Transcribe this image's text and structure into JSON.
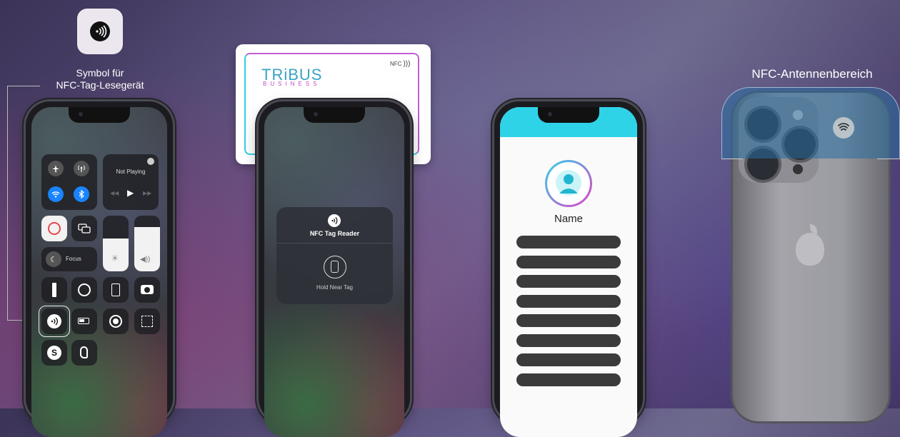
{
  "labels": {
    "reader_symbol_line1": "Symbol für",
    "reader_symbol_line2": "NFC-Tag-Lesegerät",
    "antenna_area": "NFC-Antennenbereich"
  },
  "control_center": {
    "now_playing": "Not Playing",
    "focus_label": "Focus"
  },
  "card": {
    "brand": "TRiBUS",
    "sub": "BUSINESS",
    "nfc_label": "NFC"
  },
  "nfc_reader_popup": {
    "title": "NFC Tag Reader",
    "hint": "Hold Near Tag"
  },
  "profile": {
    "name": "Name",
    "field_count": 8
  },
  "colors": {
    "accent_cyan": "#2fd3e8",
    "accent_pink": "#e040c8",
    "antenna_blue": "#2b6f9a",
    "cc_blue": "#1a84ff"
  }
}
